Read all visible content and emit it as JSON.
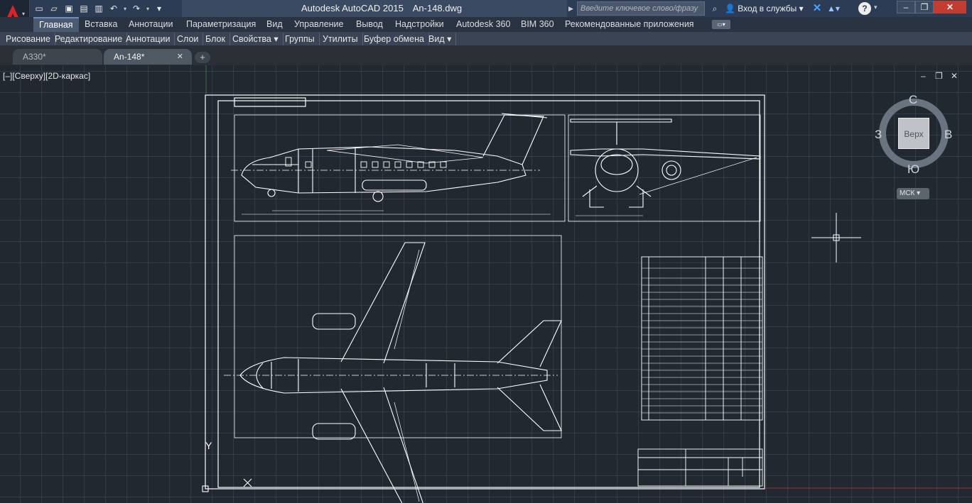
{
  "app": {
    "title": "Autodesk AutoCAD 2015",
    "filename": "An-148.dwg"
  },
  "search": {
    "placeholder": "Введите ключевое слово/фразу"
  },
  "account": {
    "signin_label": "Вход в службы"
  },
  "ribbon": {
    "tabs": [
      "Главная",
      "Вставка",
      "Аннотации",
      "Параметризация",
      "Вид",
      "Управление",
      "Вывод",
      "Надстройки",
      "Autodesk 360",
      "BIM 360",
      "Рекомендованные приложения"
    ],
    "active_tab": "Главная",
    "panels": [
      "Рисование",
      "Редактирование",
      "Аннотации",
      "Слои",
      "Блок",
      "Свойства",
      "Группы",
      "Утилиты",
      "Буфер обмена",
      "Вид"
    ],
    "panel_expand": "▾"
  },
  "file_tabs": [
    {
      "label": "A330*",
      "active": false
    },
    {
      "label": "An-148*",
      "active": true
    }
  ],
  "viewport": {
    "label": "[–][Сверху][2D-каркас]"
  },
  "viewcube": {
    "north": "С",
    "south": "Ю",
    "west": "З",
    "east": "В",
    "face": "Верх",
    "ucs": "МСК"
  },
  "axis": {
    "y_label": "Y"
  },
  "colors": {
    "canvas": "#212830",
    "grid": "#3c4a5c",
    "drawing_lines": "#ffffff",
    "accent": "#c43c30"
  }
}
